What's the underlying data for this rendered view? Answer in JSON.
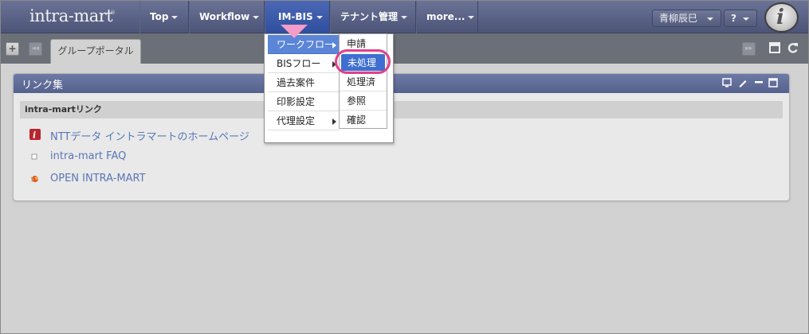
{
  "logo": {
    "text": "intra-mart",
    "mark": "®"
  },
  "nav": {
    "items": [
      {
        "label": "Top"
      },
      {
        "label": "Workflow"
      },
      {
        "label": "IM-BIS"
      },
      {
        "label": "テナント管理"
      },
      {
        "label": "more..."
      }
    ],
    "user_name": "青柳辰巳",
    "help_label": "?",
    "avatar_letter": "i"
  },
  "tabs": {
    "add_label": "+",
    "prev_label": "◂◂",
    "next_label": "▸▸",
    "active_tab": "グループポータル"
  },
  "portlet": {
    "title": "リンク集",
    "section_title": "intra-martリンク",
    "links": [
      {
        "label": "NTTデータ イントラマートのホームページ",
        "icon": "intramart-logo-icon"
      },
      {
        "label": "intra-mart FAQ",
        "icon": "faq-icon"
      },
      {
        "label": "OPEN INTRA-MART",
        "icon": "open-intramart-icon"
      }
    ]
  },
  "menu": {
    "items": [
      {
        "label": "ワークフロー",
        "has_sub": true
      },
      {
        "label": "BISフロー",
        "has_sub": true
      },
      {
        "label": "過去案件",
        "has_sub": false
      },
      {
        "label": "印影設定",
        "has_sub": false
      },
      {
        "label": "代理設定",
        "has_sub": true
      }
    ],
    "submenu": [
      {
        "label": "申請"
      },
      {
        "label": "未処理"
      },
      {
        "label": "処理済"
      },
      {
        "label": "参照"
      },
      {
        "label": "確認"
      }
    ]
  },
  "colors": {
    "nav_bg": "#5a6286",
    "active_nav": "#3a5aa8",
    "menu_selected": "#5b85d7",
    "highlight": "#e0408a"
  }
}
